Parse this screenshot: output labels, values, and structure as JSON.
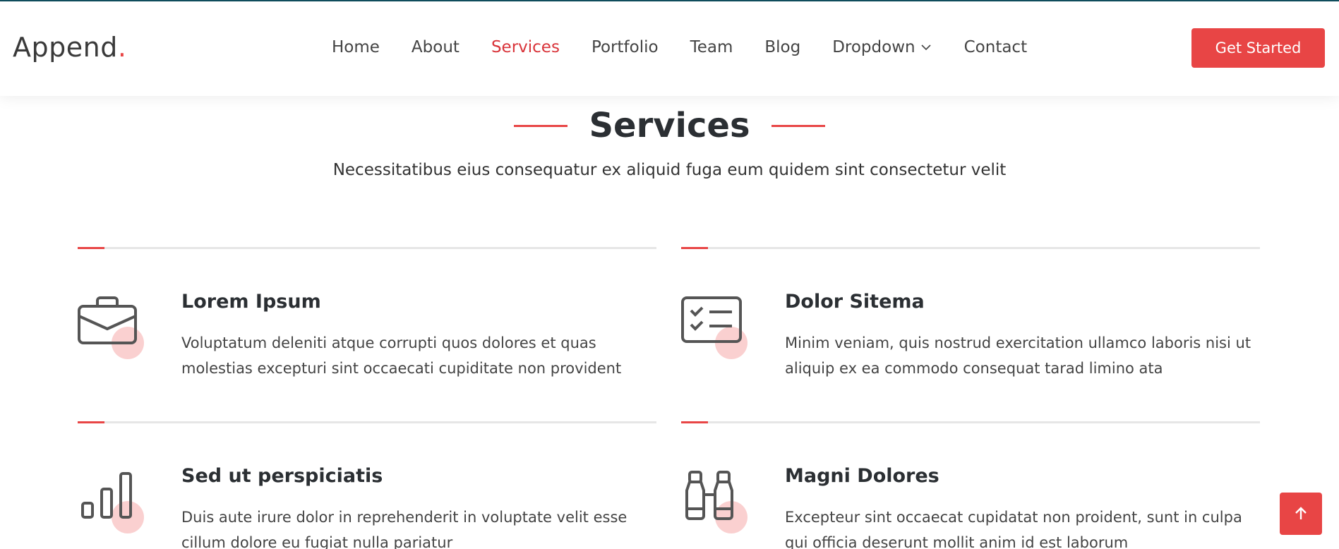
{
  "header": {
    "logo_text": "Append",
    "logo_dot": ".",
    "nav": [
      {
        "label": "Home"
      },
      {
        "label": "About"
      },
      {
        "label": "Services"
      },
      {
        "label": "Portfolio"
      },
      {
        "label": "Team"
      },
      {
        "label": "Blog"
      },
      {
        "label": "Dropdown"
      },
      {
        "label": "Contact"
      }
    ],
    "cta_label": "Get Started"
  },
  "section": {
    "title": "Services",
    "subtitle": "Necessitatibus eius consequatur ex aliquid fuga eum quidem sint consectetur velit"
  },
  "services": [
    {
      "title": "Lorem Ipsum",
      "icon": "briefcase-icon",
      "text": "Voluptatum deleniti atque corrupti quos dolores et quas molestias excepturi sint occaecati cupiditate non provident"
    },
    {
      "title": "Dolor Sitema",
      "icon": "card-checklist-icon",
      "text": "Minim veniam, quis nostrud exercitation ullamco laboris nisi ut aliquip ex ea commodo consequat tarad limino ata"
    },
    {
      "title": "Sed ut perspiciatis",
      "icon": "bar-chart-icon",
      "text": "Duis aute irure dolor in reprehenderit in voluptate velit esse cillum dolore eu fugiat nulla pariatur"
    },
    {
      "title": "Magni Dolores",
      "icon": "binoculars-icon",
      "text": "Excepteur sint occaecat cupidatat non proident, sunt in culpa qui officia deserunt mollit anim id est laborum"
    }
  ],
  "colors": {
    "accent": "#e84545",
    "heading": "#2b2f33",
    "text": "#444444"
  }
}
